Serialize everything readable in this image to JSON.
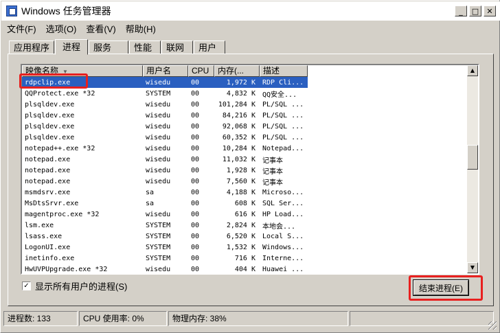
{
  "window": {
    "title": "Windows 任务管理器",
    "icon": "task-manager-icon",
    "controls": {
      "minimize": "_",
      "maximize": "□",
      "close": "✕"
    }
  },
  "menubar": {
    "items": [
      "文件(F)",
      "选项(O)",
      "查看(V)",
      "帮助(H)"
    ]
  },
  "tabs": {
    "items": [
      "应用程序",
      "进程",
      "服务",
      "性能",
      "联网",
      "用户"
    ],
    "active": "进程"
  },
  "processes": {
    "columns": [
      "映像名称",
      "用户名",
      "CPU",
      "内存(...",
      "描述"
    ],
    "sort_indicator": "▼",
    "selected_index": 0,
    "rows": [
      {
        "name": "rdpclip.exe",
        "user": "wisedu",
        "cpu": "00",
        "mem": "1,972 K",
        "desc": "RDP Cli..."
      },
      {
        "name": "QQProtect.exe *32",
        "user": "SYSTEM",
        "cpu": "00",
        "mem": "4,832 K",
        "desc": "QQ安全..."
      },
      {
        "name": "plsqldev.exe",
        "user": "wisedu",
        "cpu": "00",
        "mem": "101,284 K",
        "desc": "PL/SQL ..."
      },
      {
        "name": "plsqldev.exe",
        "user": "wisedu",
        "cpu": "00",
        "mem": "84,216 K",
        "desc": "PL/SQL ..."
      },
      {
        "name": "plsqldev.exe",
        "user": "wisedu",
        "cpu": "00",
        "mem": "92,068 K",
        "desc": "PL/SQL ..."
      },
      {
        "name": "plsqldev.exe",
        "user": "wisedu",
        "cpu": "00",
        "mem": "60,352 K",
        "desc": "PL/SQL ..."
      },
      {
        "name": "notepad++.exe *32",
        "user": "wisedu",
        "cpu": "00",
        "mem": "10,284 K",
        "desc": "Notepad..."
      },
      {
        "name": "notepad.exe",
        "user": "wisedu",
        "cpu": "00",
        "mem": "11,032 K",
        "desc": "记事本"
      },
      {
        "name": "notepad.exe",
        "user": "wisedu",
        "cpu": "00",
        "mem": "1,928 K",
        "desc": "记事本"
      },
      {
        "name": "notepad.exe",
        "user": "wisedu",
        "cpu": "00",
        "mem": "7,560 K",
        "desc": "记事本"
      },
      {
        "name": "msmdsrv.exe",
        "user": "sa",
        "cpu": "00",
        "mem": "4,188 K",
        "desc": "Microso..."
      },
      {
        "name": "MsDtsSrvr.exe",
        "user": "sa",
        "cpu": "00",
        "mem": "608 K",
        "desc": "SQL Ser..."
      },
      {
        "name": "magentproc.exe *32",
        "user": "wisedu",
        "cpu": "00",
        "mem": "616 K",
        "desc": "HP Load..."
      },
      {
        "name": "lsm.exe",
        "user": "SYSTEM",
        "cpu": "00",
        "mem": "2,824 K",
        "desc": "本地会..."
      },
      {
        "name": "lsass.exe",
        "user": "SYSTEM",
        "cpu": "00",
        "mem": "6,520 K",
        "desc": "Local S..."
      },
      {
        "name": "LogonUI.exe",
        "user": "SYSTEM",
        "cpu": "00",
        "mem": "1,532 K",
        "desc": "Windows..."
      },
      {
        "name": "inetinfo.exe",
        "user": "SYSTEM",
        "cpu": "00",
        "mem": "716 K",
        "desc": "Interne..."
      },
      {
        "name": "HwUVPUpgrade.exe *32",
        "user": "wisedu",
        "cpu": "00",
        "mem": "404 K",
        "desc": "Huawei ..."
      }
    ]
  },
  "show_all_users": {
    "label": "显示所有用户的进程(S)",
    "checked": true,
    "check_glyph": "✓"
  },
  "end_process_button": {
    "label": "结束进程(E)"
  },
  "statusbar": {
    "process_count": "进程数: 133",
    "cpu_usage": "CPU 使用率: 0%",
    "physical_memory": "物理内存: 38%"
  },
  "colors": {
    "annotation": "#e8201f",
    "selection": "#2a5fc0",
    "face": "#d4d0c8"
  }
}
